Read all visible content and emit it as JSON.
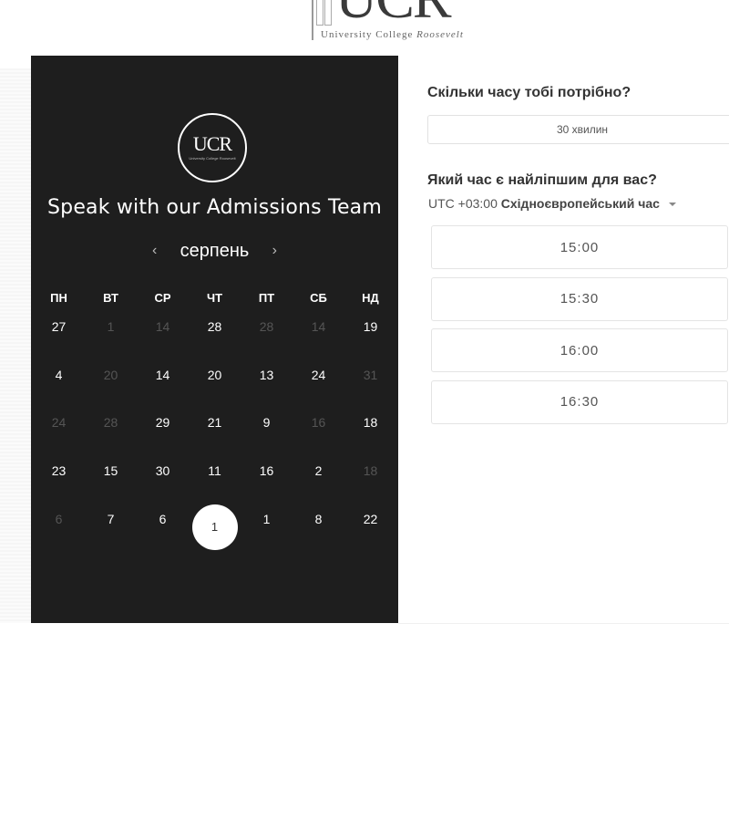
{
  "logo": {
    "letters": "UCR",
    "subtitle_plain": "University College ",
    "subtitle_italic": "Roosevelt"
  },
  "calendar": {
    "title": "Speak with our Admissions Team",
    "month": "серпень",
    "prev_icon": "chevron-left-icon",
    "next_icon": "chevron-right-icon",
    "weekdays": [
      "ПН",
      "ВТ",
      "СР",
      "ЧТ",
      "ПТ",
      "СБ",
      "НД"
    ],
    "rows": [
      [
        {
          "d": "27",
          "a": true
        },
        {
          "d": "1",
          "a": false
        },
        {
          "d": "14",
          "a": false
        },
        {
          "d": "28",
          "a": true
        },
        {
          "d": "28",
          "a": false
        },
        {
          "d": "14",
          "a": false
        },
        {
          "d": "19",
          "a": true
        }
      ],
      [
        {
          "d": "4",
          "a": true
        },
        {
          "d": "20",
          "a": false
        },
        {
          "d": "14",
          "a": true
        },
        {
          "d": "20",
          "a": true
        },
        {
          "d": "13",
          "a": true
        },
        {
          "d": "24",
          "a": true
        },
        {
          "d": "31",
          "a": false
        }
      ],
      [
        {
          "d": "24",
          "a": false
        },
        {
          "d": "28",
          "a": false
        },
        {
          "d": "29",
          "a": true
        },
        {
          "d": "21",
          "a": true
        },
        {
          "d": "9",
          "a": true
        },
        {
          "d": "16",
          "a": false
        },
        {
          "d": "18",
          "a": true
        }
      ],
      [
        {
          "d": "23",
          "a": true
        },
        {
          "d": "15",
          "a": true
        },
        {
          "d": "30",
          "a": true
        },
        {
          "d": "11",
          "a": true
        },
        {
          "d": "16",
          "a": true
        },
        {
          "d": "2",
          "a": true
        },
        {
          "d": "18",
          "a": false
        }
      ],
      [
        {
          "d": "6",
          "a": false
        },
        {
          "d": "7",
          "a": true
        },
        {
          "d": "6",
          "a": true
        },
        {
          "d": "1",
          "a": true,
          "selected": true
        },
        {
          "d": "1",
          "a": true
        },
        {
          "d": "8",
          "a": true
        },
        {
          "d": "22",
          "a": true
        }
      ]
    ]
  },
  "booking": {
    "duration_question": "Скільки часу тобі потрібно?",
    "duration_value": "30 хвилин",
    "time_question": "Який час є найліпшим для вас?",
    "timezone_offset": "UTC +03:00",
    "timezone_name": "Східноєвропейський час",
    "slots": [
      "15:00",
      "15:30",
      "16:00",
      "16:30"
    ]
  },
  "colors": {
    "card_background": "#1e1e1e",
    "selected_day_background": "#ffffff",
    "inactive_day": "#555555"
  }
}
